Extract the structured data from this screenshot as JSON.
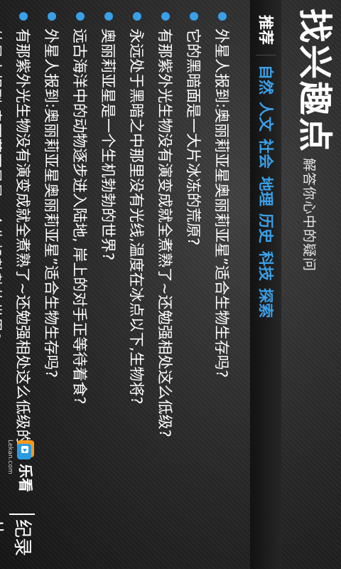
{
  "header": {
    "title": "找兴趣点",
    "subtitle": "解答你心中的疑问"
  },
  "categories": [
    {
      "label": "推荐",
      "active": true
    },
    {
      "label": "自然",
      "active": false
    },
    {
      "label": "人文",
      "active": false
    },
    {
      "label": "社会",
      "active": false
    },
    {
      "label": "地理",
      "active": false
    },
    {
      "label": "历史",
      "active": false
    },
    {
      "label": "科技",
      "active": false
    },
    {
      "label": "探索",
      "active": false
    }
  ],
  "questions": [
    "外星人报到:奥丽莉亚星奥丽莉亚星”适合生物生存吗?",
    "它的黑暗面是一大片冰冻的荒原?",
    "有那紫外光生物没有演变成就全煮熟了~还勉强相处这么低级?",
    "永远处于黑暗之中那里没有光线,温度在冰点以下,生物将?",
    "奥丽莉亚星是一个生机勃勃的世界?",
    "远古海洋中的动物逐步进入陆地, 岸上的对手正等待着食?",
    "外星人报到:奥丽莉亚星奥丽莉亚星”适合生物生存吗?",
    "有那紫外光生物没有演变成就全煮熟了~还勉强相处这么低级的",
    "外星人报到:奥丽莉亚星是一个生机勃勃的世界?"
  ],
  "footer": {
    "brand": "乐看",
    "domain": "Lekan.com",
    "section": "纪录片"
  },
  "colors": {
    "accent": "#3aa0e8",
    "background": "#262626",
    "text": "#ffffff"
  }
}
